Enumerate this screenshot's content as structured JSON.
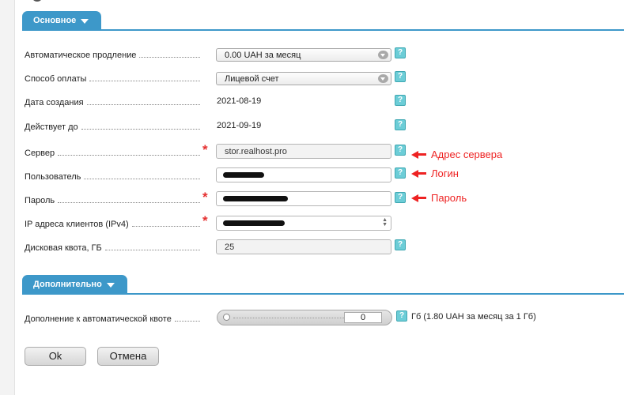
{
  "sections": {
    "main": {
      "title": "Основное"
    },
    "extra": {
      "title": "Дополнительно"
    }
  },
  "fields": {
    "auto_renew": {
      "label": "Автоматическое продление",
      "value": "0.00 UAH за месяц"
    },
    "payment_method": {
      "label": "Способ оплаты",
      "value": "Лицевой счет"
    },
    "created": {
      "label": "Дата создания",
      "value": "2021-08-19"
    },
    "valid_until": {
      "label": "Действует до",
      "value": "2021-09-19"
    },
    "server": {
      "label": "Сервер",
      "value": "stor.realhost.pro"
    },
    "user": {
      "label": "Пользователь"
    },
    "password": {
      "label": "Пароль"
    },
    "ip": {
      "label": "IP адреса клиентов (IPv4)"
    },
    "quota": {
      "label": "Дисковая квота, ГБ",
      "value": "25"
    },
    "extra_quota": {
      "label": "Дополнение к автоматической квоте",
      "value": "0",
      "unit": "Гб (1.80 UAH за месяц за 1 Гб)"
    }
  },
  "required_mark": "*",
  "help_mark": "?",
  "annotations": {
    "server": "Адрес сервера",
    "user": "Логин",
    "password": "Пароль"
  },
  "buttons": {
    "ok": "Ok",
    "cancel": "Отмена"
  },
  "colors": {
    "accent": "#3d98c9",
    "required": "#e53030",
    "annotation": "#e22222",
    "help": "#6ccdd7"
  }
}
